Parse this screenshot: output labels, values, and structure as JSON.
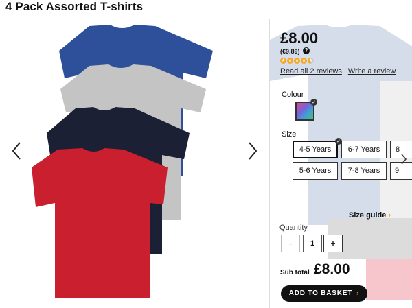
{
  "product": {
    "title": "4 Pack Assorted T-shirts"
  },
  "gallery": {
    "prev_icon": "chevron-left-icon",
    "next_icon": "chevron-right-icon",
    "shirt_colors": {
      "blue": "#2e4f9a",
      "grey": "#c4c4c4",
      "navy": "#1c2035",
      "red": "#c91f2e"
    }
  },
  "pricing": {
    "price": "£8.00",
    "alt_price": "(€9.89)",
    "help_glyph": "?",
    "rating": 4.5,
    "rating_max": 5,
    "read_reviews": "Read all 2 reviews",
    "separator": "|",
    "write_review": "Write a review"
  },
  "options": {
    "colour_label": "Colour",
    "size_label": "Size",
    "sizes": [
      "4-5 Years",
      "6-7 Years",
      "8",
      "5-6 Years",
      "7-8 Years",
      "9"
    ],
    "selected_size": "4-5 Years",
    "size_guide": "Size guide",
    "size_guide_chevron": "›"
  },
  "quantity": {
    "label": "Quantity",
    "minus": "-",
    "value": "1",
    "plus": "+"
  },
  "summary": {
    "subtotal_label": "Sub total",
    "subtotal_value": "£8.00",
    "basket_label": "ADD TO BASKET",
    "basket_chevron": "›"
  },
  "colors": {
    "accent": "#f5a623",
    "button_dark": "#111111"
  }
}
